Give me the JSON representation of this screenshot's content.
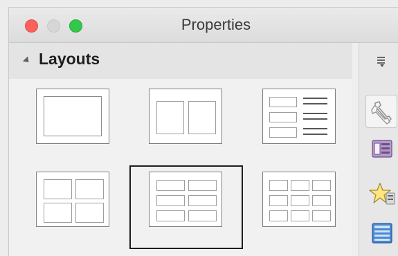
{
  "window": {
    "title": "Properties"
  },
  "section": {
    "title": "Layouts"
  },
  "layouts": [
    {
      "name": "title-only"
    },
    {
      "name": "two-content"
    },
    {
      "name": "title-content-list"
    },
    {
      "name": "four-content"
    },
    {
      "name": "six-content"
    },
    {
      "name": "nine-content"
    }
  ],
  "sidebar": {
    "tabs": [
      {
        "icon": "wrench-icon"
      },
      {
        "icon": "slide-list-icon"
      },
      {
        "icon": "star-icon"
      },
      {
        "icon": "navigator-icon"
      }
    ]
  }
}
